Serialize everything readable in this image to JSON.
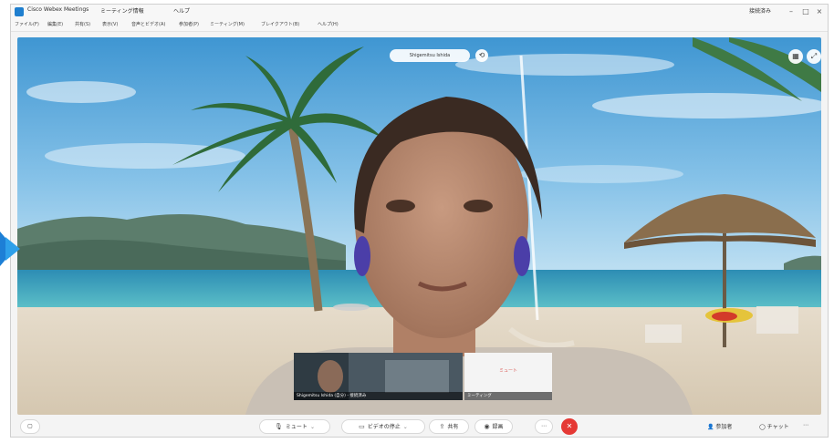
{
  "window": {
    "app_title": "Cisco Webex Meetings",
    "crumb1": "ミーティング情報",
    "crumb2": "ヘルプ",
    "user_label": "接続済み"
  },
  "menu": {
    "items": [
      "ファイル(F)",
      "編集(E)",
      "共有(S)",
      "表示(V)",
      "音声とビデオ(A)",
      "参加者(P)",
      "ミーティング(M)",
      "ブレイクアウト(B)",
      "ヘルプ(H)"
    ]
  },
  "stage": {
    "speaker_name": "Shigemitsu Ishida",
    "thumbnails": [
      {
        "label": "Shigemitsu Ishida (自分) - 接続済み"
      },
      {
        "label": "ミーティング",
        "status": "ミュート"
      }
    ]
  },
  "controls": {
    "mute_label": "ミュート",
    "video_label": "ビデオの停止",
    "share_label": "共有",
    "record_label": "録画",
    "participants_label": "参加者",
    "chat_label": "チャット"
  },
  "colors": {
    "end_button": "#e53935",
    "accent": "#1f7fcf"
  }
}
